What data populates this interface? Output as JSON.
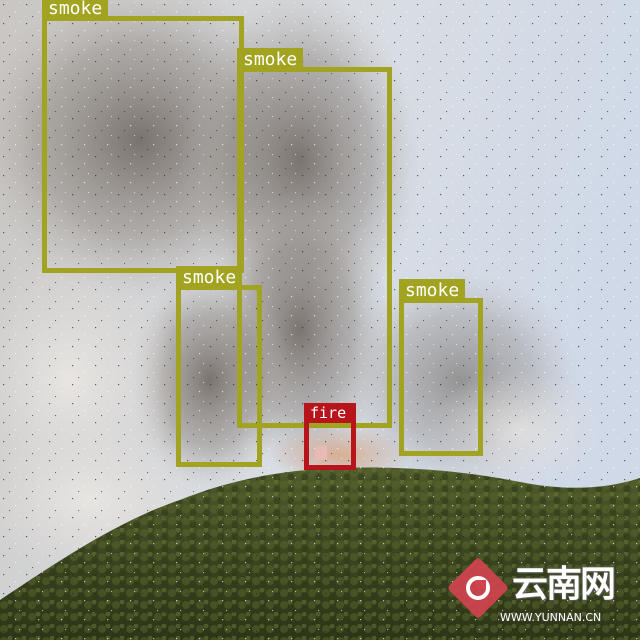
{
  "image": {
    "description_free": true,
    "colors": {
      "smoke_box": "#a3a322",
      "fire_box": "#b8141c"
    }
  },
  "detections": [
    {
      "label": "smoke",
      "class": "smoke"
    },
    {
      "label": "smoke",
      "class": "smoke"
    },
    {
      "label": "smoke",
      "class": "smoke"
    },
    {
      "label": "smoke",
      "class": "smoke"
    },
    {
      "label": "fire",
      "class": "fire"
    }
  ],
  "watermark": {
    "logo_text": "云南网",
    "url": "WWW.YUNNAN.CN"
  }
}
